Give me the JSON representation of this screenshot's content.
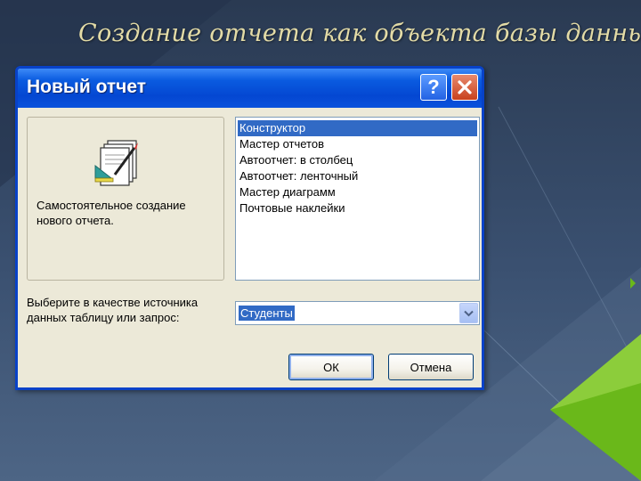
{
  "slide": {
    "title": "Создание отчета как объекта базы данных"
  },
  "dialog": {
    "title": "Новый отчет",
    "help_icon": "question-mark-icon",
    "close_icon": "close-icon",
    "description": "Самостоятельное создание нового отчета.",
    "wizard_icon": "report-design-icon",
    "list_items": [
      "Конструктор",
      "Мастер отчетов",
      "Автоотчет: в столбец",
      "Автоотчет: ленточный",
      "Мастер диаграмм",
      "Почтовые наклейки"
    ],
    "selected_item": "Конструктор",
    "source_label": "Выберите в качестве источника данных таблицу или запрос:",
    "source_value": "Студенты",
    "ok_label": "ОК",
    "cancel_label": "Отмена"
  },
  "colors": {
    "titlebar": "#0447d2",
    "selection": "#316ac5",
    "dialog_bg": "#ece9d8",
    "slide_title": "#e3dba6",
    "accent_green": "#7dc31e"
  }
}
